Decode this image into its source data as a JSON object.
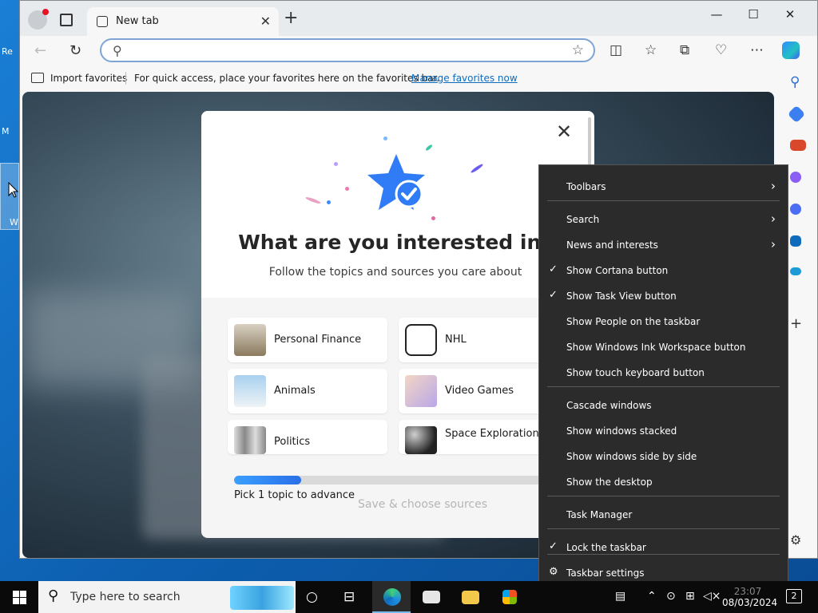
{
  "browser": {
    "tab_title": "New tab",
    "fav_import": "Import favorites",
    "fav_message": "For quick access, place your favorites here on the favorites bar.",
    "fav_link": "Manage favorites now",
    "address_value": ""
  },
  "modal": {
    "title": "What are you interested in?",
    "subtitle": "Follow the topics and sources you care about",
    "topics": [
      {
        "label": "Personal Finance"
      },
      {
        "label": "NHL"
      },
      {
        "label": "Animals"
      },
      {
        "label": "Video Games"
      },
      {
        "label": "Politics"
      },
      {
        "label": "Space Exploration"
      }
    ],
    "progress_fraction": 0.19,
    "pick_text": "Pick 1 topic to advance",
    "save_button": "Save & choose sources"
  },
  "context_menu": {
    "items": [
      {
        "label": "Toolbars",
        "submenu": true,
        "checked": false
      },
      {
        "label": "Search",
        "submenu": true,
        "checked": false
      },
      {
        "label": "News and interests",
        "submenu": true,
        "checked": false
      },
      {
        "label": "Show Cortana button",
        "submenu": false,
        "checked": true
      },
      {
        "label": "Show Task View button",
        "submenu": false,
        "checked": true
      },
      {
        "label": "Show People on the taskbar",
        "submenu": false,
        "checked": false
      },
      {
        "label": "Show Windows Ink Workspace button",
        "submenu": false,
        "checked": false
      },
      {
        "label": "Show touch keyboard button",
        "submenu": false,
        "checked": false
      },
      {
        "label": "Cascade windows",
        "submenu": false,
        "checked": false
      },
      {
        "label": "Show windows stacked",
        "submenu": false,
        "checked": false
      },
      {
        "label": "Show windows side by side",
        "submenu": false,
        "checked": false
      },
      {
        "label": "Show the desktop",
        "submenu": false,
        "checked": false
      },
      {
        "label": "Task Manager",
        "submenu": false,
        "checked": false
      },
      {
        "label": "Lock the taskbar",
        "submenu": false,
        "checked": true
      },
      {
        "label": "Taskbar settings",
        "submenu": false,
        "checked": false,
        "icon": "gear-icon"
      }
    ]
  },
  "taskbar": {
    "search_placeholder": "Type here to search",
    "date": "08/03/2024",
    "time": "23:07",
    "notification_count": "2"
  },
  "desktop": {
    "icons": [
      "Re",
      "M",
      "W"
    ]
  },
  "colors": {
    "accent": "#0f6cbd",
    "menu_bg": "#2b2b2b",
    "taskbar_bg": "#0a0a0a"
  }
}
